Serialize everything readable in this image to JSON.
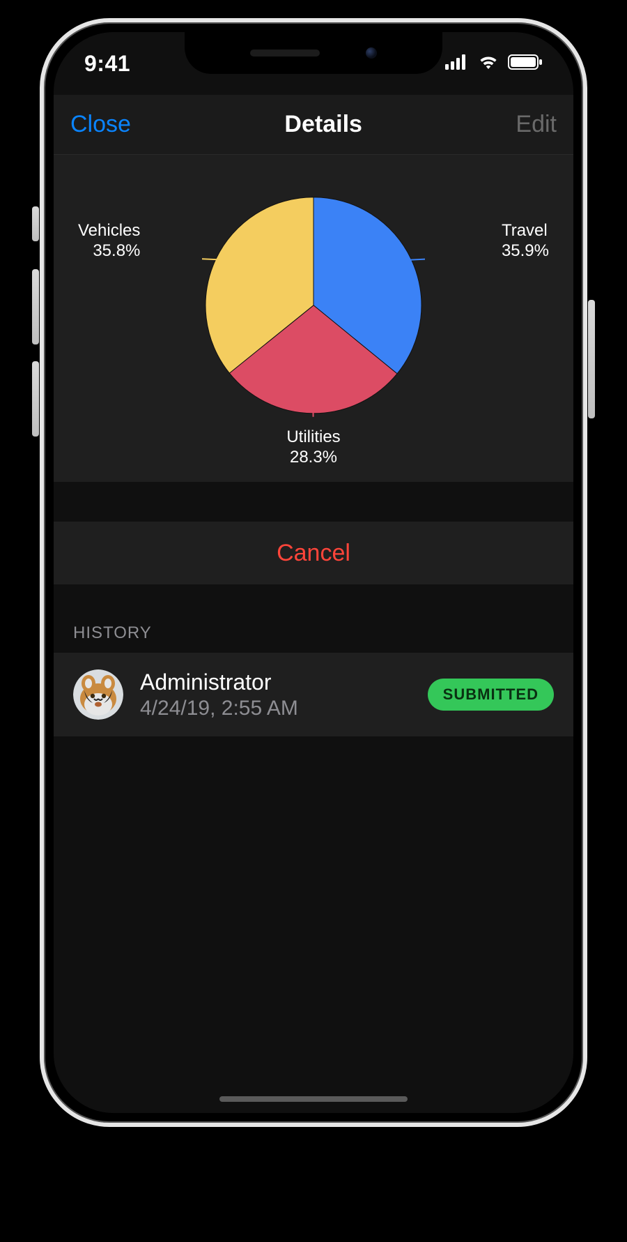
{
  "status_bar": {
    "time": "9:41"
  },
  "nav": {
    "close_label": "Close",
    "title": "Details",
    "edit_label": "Edit"
  },
  "chart_data": {
    "type": "pie",
    "title": "",
    "series": [
      {
        "name": "Travel",
        "value": 35.9,
        "color": "#3b82f6"
      },
      {
        "name": "Utilities",
        "value": 28.3,
        "color": "#dc4c64"
      },
      {
        "name": "Vehicles",
        "value": 35.8,
        "color": "#f4cd5f"
      }
    ]
  },
  "actions": {
    "cancel_label": "Cancel"
  },
  "history": {
    "header": "HISTORY",
    "items": [
      {
        "name": "Administrator",
        "timestamp": "4/24/19, 2:55 AM",
        "status": "SUBMITTED"
      }
    ]
  }
}
